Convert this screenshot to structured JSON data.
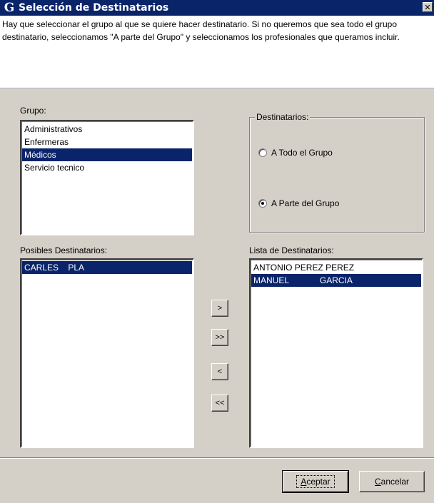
{
  "window": {
    "title": "Selección de Destinatarios",
    "app_icon": "G",
    "close_label": "✕"
  },
  "help": {
    "text": "Hay que seleccionar el grupo al que se quiere hacer destinatario. Si no queremos que sea todo el grupo destinatario, seleccionamos \"A parte del Grupo\" y seleccionamos los profesionales que queramos incluir."
  },
  "grupo": {
    "label": "Grupo:",
    "items": [
      "Administrativos",
      "Enfermeras",
      "Médicos",
      "Servicio tecnico"
    ],
    "selected_index": 2
  },
  "destinatarios": {
    "title": "Destinatarios:",
    "options": [
      "A Todo el Grupo",
      "A Parte del Grupo"
    ],
    "selected_index": 1
  },
  "posibles": {
    "label": "Posibles Destinatarios:",
    "items": [
      "CARLES    PLA"
    ],
    "selected_index": 0
  },
  "lista": {
    "label": "Lista de Destinatarios:",
    "items": [
      "ANTONIO PEREZ PEREZ",
      "MANUEL             GARCIA"
    ],
    "selected_index": 1
  },
  "move_buttons": {
    "add": ">",
    "add_all": ">>",
    "remove": "<",
    "remove_all": "<<"
  },
  "footer": {
    "accept_mnemonic": "A",
    "accept_rest": "ceptar",
    "cancel_mnemonic": "C",
    "cancel_rest": "ancelar"
  }
}
